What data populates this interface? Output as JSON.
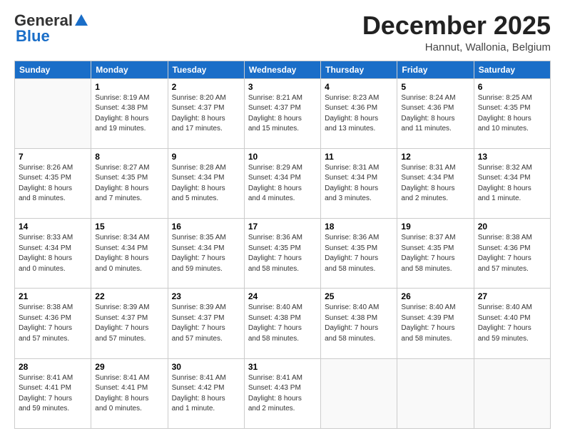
{
  "header": {
    "logo_general": "General",
    "logo_blue": "Blue",
    "month_title": "December 2025",
    "location": "Hannut, Wallonia, Belgium"
  },
  "days_of_week": [
    "Sunday",
    "Monday",
    "Tuesday",
    "Wednesday",
    "Thursday",
    "Friday",
    "Saturday"
  ],
  "weeks": [
    [
      {
        "day": "",
        "info": ""
      },
      {
        "day": "1",
        "info": "Sunrise: 8:19 AM\nSunset: 4:38 PM\nDaylight: 8 hours\nand 19 minutes."
      },
      {
        "day": "2",
        "info": "Sunrise: 8:20 AM\nSunset: 4:37 PM\nDaylight: 8 hours\nand 17 minutes."
      },
      {
        "day": "3",
        "info": "Sunrise: 8:21 AM\nSunset: 4:37 PM\nDaylight: 8 hours\nand 15 minutes."
      },
      {
        "day": "4",
        "info": "Sunrise: 8:23 AM\nSunset: 4:36 PM\nDaylight: 8 hours\nand 13 minutes."
      },
      {
        "day": "5",
        "info": "Sunrise: 8:24 AM\nSunset: 4:36 PM\nDaylight: 8 hours\nand 11 minutes."
      },
      {
        "day": "6",
        "info": "Sunrise: 8:25 AM\nSunset: 4:35 PM\nDaylight: 8 hours\nand 10 minutes."
      }
    ],
    [
      {
        "day": "7",
        "info": "Sunrise: 8:26 AM\nSunset: 4:35 PM\nDaylight: 8 hours\nand 8 minutes."
      },
      {
        "day": "8",
        "info": "Sunrise: 8:27 AM\nSunset: 4:35 PM\nDaylight: 8 hours\nand 7 minutes."
      },
      {
        "day": "9",
        "info": "Sunrise: 8:28 AM\nSunset: 4:34 PM\nDaylight: 8 hours\nand 5 minutes."
      },
      {
        "day": "10",
        "info": "Sunrise: 8:29 AM\nSunset: 4:34 PM\nDaylight: 8 hours\nand 4 minutes."
      },
      {
        "day": "11",
        "info": "Sunrise: 8:31 AM\nSunset: 4:34 PM\nDaylight: 8 hours\nand 3 minutes."
      },
      {
        "day": "12",
        "info": "Sunrise: 8:31 AM\nSunset: 4:34 PM\nDaylight: 8 hours\nand 2 minutes."
      },
      {
        "day": "13",
        "info": "Sunrise: 8:32 AM\nSunset: 4:34 PM\nDaylight: 8 hours\nand 1 minute."
      }
    ],
    [
      {
        "day": "14",
        "info": "Sunrise: 8:33 AM\nSunset: 4:34 PM\nDaylight: 8 hours\nand 0 minutes."
      },
      {
        "day": "15",
        "info": "Sunrise: 8:34 AM\nSunset: 4:34 PM\nDaylight: 8 hours\nand 0 minutes."
      },
      {
        "day": "16",
        "info": "Sunrise: 8:35 AM\nSunset: 4:34 PM\nDaylight: 7 hours\nand 59 minutes."
      },
      {
        "day": "17",
        "info": "Sunrise: 8:36 AM\nSunset: 4:35 PM\nDaylight: 7 hours\nand 58 minutes."
      },
      {
        "day": "18",
        "info": "Sunrise: 8:36 AM\nSunset: 4:35 PM\nDaylight: 7 hours\nand 58 minutes."
      },
      {
        "day": "19",
        "info": "Sunrise: 8:37 AM\nSunset: 4:35 PM\nDaylight: 7 hours\nand 58 minutes."
      },
      {
        "day": "20",
        "info": "Sunrise: 8:38 AM\nSunset: 4:36 PM\nDaylight: 7 hours\nand 57 minutes."
      }
    ],
    [
      {
        "day": "21",
        "info": "Sunrise: 8:38 AM\nSunset: 4:36 PM\nDaylight: 7 hours\nand 57 minutes."
      },
      {
        "day": "22",
        "info": "Sunrise: 8:39 AM\nSunset: 4:37 PM\nDaylight: 7 hours\nand 57 minutes."
      },
      {
        "day": "23",
        "info": "Sunrise: 8:39 AM\nSunset: 4:37 PM\nDaylight: 7 hours\nand 57 minutes."
      },
      {
        "day": "24",
        "info": "Sunrise: 8:40 AM\nSunset: 4:38 PM\nDaylight: 7 hours\nand 58 minutes."
      },
      {
        "day": "25",
        "info": "Sunrise: 8:40 AM\nSunset: 4:38 PM\nDaylight: 7 hours\nand 58 minutes."
      },
      {
        "day": "26",
        "info": "Sunrise: 8:40 AM\nSunset: 4:39 PM\nDaylight: 7 hours\nand 58 minutes."
      },
      {
        "day": "27",
        "info": "Sunrise: 8:40 AM\nSunset: 4:40 PM\nDaylight: 7 hours\nand 59 minutes."
      }
    ],
    [
      {
        "day": "28",
        "info": "Sunrise: 8:41 AM\nSunset: 4:41 PM\nDaylight: 7 hours\nand 59 minutes."
      },
      {
        "day": "29",
        "info": "Sunrise: 8:41 AM\nSunset: 4:41 PM\nDaylight: 8 hours\nand 0 minutes."
      },
      {
        "day": "30",
        "info": "Sunrise: 8:41 AM\nSunset: 4:42 PM\nDaylight: 8 hours\nand 1 minute."
      },
      {
        "day": "31",
        "info": "Sunrise: 8:41 AM\nSunset: 4:43 PM\nDaylight: 8 hours\nand 2 minutes."
      },
      {
        "day": "",
        "info": ""
      },
      {
        "day": "",
        "info": ""
      },
      {
        "day": "",
        "info": ""
      }
    ]
  ]
}
